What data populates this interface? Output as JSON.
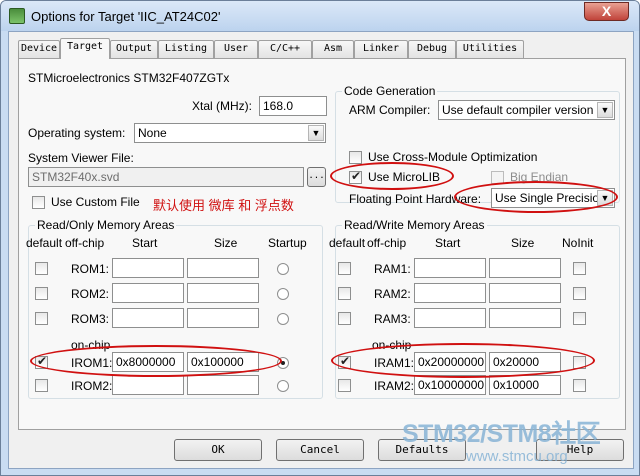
{
  "window": {
    "title": "Options for Target 'IIC_AT24C02'",
    "close_glyph": "X"
  },
  "tabs": [
    "Device",
    "Target",
    "Output",
    "Listing",
    "User",
    "C/C++",
    "Asm",
    "Linker",
    "Debug",
    "Utilities"
  ],
  "active_tab": "Target",
  "device_name": "STMicroelectronics STM32F407ZGTx",
  "xtal": {
    "label": "Xtal (MHz):",
    "value": "168.0"
  },
  "os": {
    "label": "Operating system:",
    "value": "None"
  },
  "svd": {
    "label": "System Viewer File:",
    "value": "STM32F40x.svd",
    "browse": "..."
  },
  "custom_file": {
    "label": "Use Custom File",
    "checked": false
  },
  "codegen": {
    "title": "Code Generation",
    "compiler_label": "ARM Compiler:",
    "compiler_value": "Use default compiler version",
    "cross_module": {
      "label": "Use Cross-Module Optimization",
      "checked": false
    },
    "microlib": {
      "label": "Use MicroLIB",
      "checked": true
    },
    "big_endian": {
      "label": "Big Endian",
      "checked": false
    },
    "fp_label": "Floating Point Hardware:",
    "fp_value": "Use Single Precision"
  },
  "annotation": "默认使用 微库 和 浮点数",
  "ro": {
    "title": "Read/Only Memory Areas",
    "headers": {
      "default": "default",
      "offchip": "off-chip",
      "start": "Start",
      "size": "Size",
      "startup": "Startup"
    },
    "onchip": "on-chip",
    "rows": [
      {
        "name": "ROM1:",
        "start": "",
        "size": "",
        "default": false,
        "startup": false
      },
      {
        "name": "ROM2:",
        "start": "",
        "size": "",
        "default": false,
        "startup": false
      },
      {
        "name": "ROM3:",
        "start": "",
        "size": "",
        "default": false,
        "startup": false
      },
      {
        "name": "IROM1:",
        "start": "0x8000000",
        "size": "0x100000",
        "default": true,
        "startup": true
      },
      {
        "name": "IROM2:",
        "start": "",
        "size": "",
        "default": false,
        "startup": false
      }
    ]
  },
  "rw": {
    "title": "Read/Write Memory Areas",
    "headers": {
      "default": "default",
      "offchip": "off-chip",
      "start": "Start",
      "size": "Size",
      "noinit": "NoInit"
    },
    "onchip": "on-chip",
    "rows": [
      {
        "name": "RAM1:",
        "start": "",
        "size": "",
        "default": false,
        "noinit": false
      },
      {
        "name": "RAM2:",
        "start": "",
        "size": "",
        "default": false,
        "noinit": false
      },
      {
        "name": "RAM3:",
        "start": "",
        "size": "",
        "default": false,
        "noinit": false
      },
      {
        "name": "IRAM1:",
        "start": "0x20000000",
        "size": "0x20000",
        "default": true,
        "noinit": false
      },
      {
        "name": "IRAM2:",
        "start": "0x10000000",
        "size": "0x10000",
        "default": false,
        "noinit": false
      }
    ]
  },
  "buttons": {
    "ok": "OK",
    "cancel": "Cancel",
    "defaults": "Defaults",
    "help": "Help"
  },
  "watermark": {
    "main": "STM32/STM8社区",
    "url": "www.stmcu.org"
  },
  "colors": {
    "annotation": "#d01010",
    "title_bar": "#c9dcf2",
    "watermark": "#88b4d6"
  }
}
